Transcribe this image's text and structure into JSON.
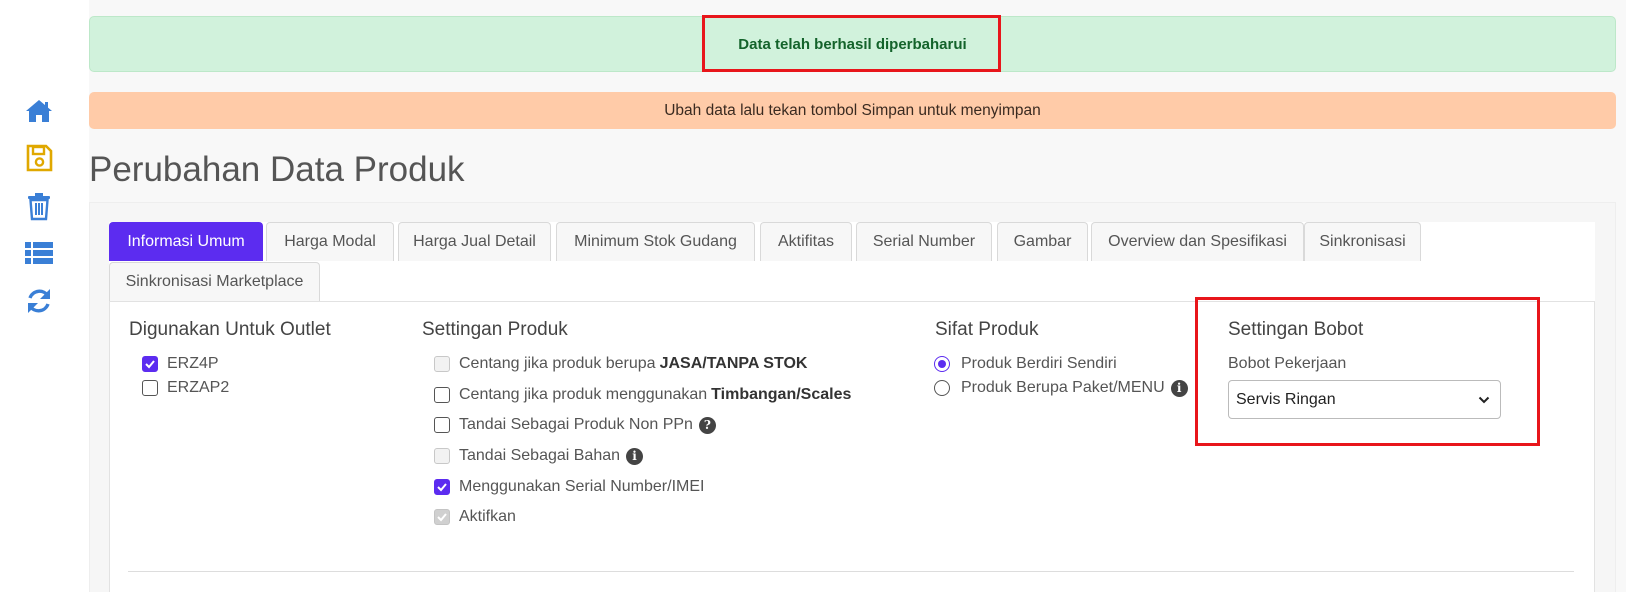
{
  "sidebar": {
    "icons": [
      "home-icon",
      "save-icon",
      "trash-icon",
      "list-icon",
      "refresh-icon"
    ]
  },
  "alerts": {
    "success": "Data telah berhasil diperbaharui",
    "warning": "Ubah data lalu tekan tombol Simpan untuk menyimpan"
  },
  "page": {
    "title": "Perubahan Data Produk"
  },
  "tabs": [
    {
      "label": "Informasi Umum",
      "active": true
    },
    {
      "label": "Harga Modal"
    },
    {
      "label": "Harga Jual Detail"
    },
    {
      "label": "Minimum Stok Gudang"
    },
    {
      "label": "Aktifitas"
    },
    {
      "label": "Serial Number"
    },
    {
      "label": "Gambar"
    },
    {
      "label": "Overview dan Spesifikasi"
    },
    {
      "label": "Sinkronisasi"
    },
    {
      "label": "Sinkronisasi Marketplace"
    }
  ],
  "outlet": {
    "title": "Digunakan Untuk Outlet",
    "items": [
      {
        "label": "ERZ4P",
        "checked": true
      },
      {
        "label": "ERZAP2",
        "checked": false
      }
    ]
  },
  "produk": {
    "title": "Settingan Produk",
    "items": [
      {
        "label": "Centang jika produk berupa",
        "bold": "JASA/TANPA STOK",
        "state": "disabled"
      },
      {
        "label": "Centang jika produk menggunakan",
        "bold": "Timbangan/Scales",
        "state": "unchecked"
      },
      {
        "label": "Tandai Sebagai Produk Non PPn",
        "state": "unchecked",
        "icon": "question-circle-icon"
      },
      {
        "label": "Tandai Sebagai Bahan",
        "state": "disabled",
        "icon": "info-circle-icon"
      },
      {
        "label": "Menggunakan Serial Number/IMEI",
        "state": "checked"
      },
      {
        "label": "Aktifkan",
        "state": "disabled-checked"
      }
    ]
  },
  "sifat": {
    "title": "Sifat Produk",
    "options": [
      {
        "label": "Produk Berdiri Sendiri",
        "selected": true
      },
      {
        "label": "Produk Berupa Paket/MENU",
        "icon": "info-circle-icon"
      }
    ]
  },
  "bobot": {
    "title": "Settingan Bobot",
    "field_label": "Bobot Pekerjaan",
    "selected": "Servis Ringan"
  },
  "colors": {
    "accent": "#5c2cf0",
    "success_bg": "#d1f2dc",
    "warning_bg": "#ffcba8",
    "highlight": "#e8161b"
  }
}
